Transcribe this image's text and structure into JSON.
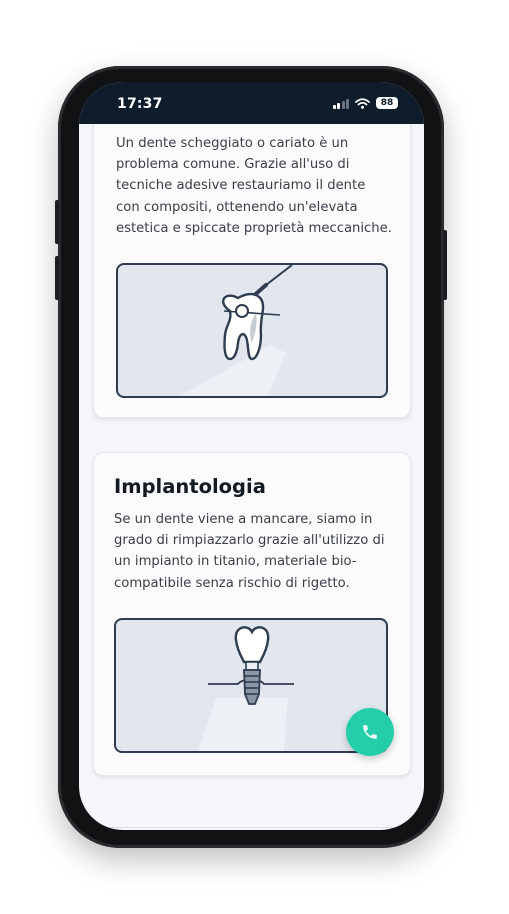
{
  "status_bar": {
    "time": "17:37",
    "battery": "88",
    "icons": [
      "signal-icon",
      "wifi-icon",
      "battery-icon"
    ]
  },
  "cards": [
    {
      "text": "Un dente scheggiato o cariato è un problema comune. Grazie all'uso di tecniche adesive restauriamo il dente con compositi, ottenendo un'elevata estetica e spiccate proprietà meccaniche.",
      "illustration": "tooth-restoration-icon"
    },
    {
      "title": "Implantologia",
      "text": "Se un dente viene a mancare, siamo in grado di rimpiazzarlo grazie all'utilizzo di un impianto in titanio, materiale bio-compatibile senza rischio di rigetto.",
      "illustration": "dental-implant-icon"
    }
  ],
  "call_button": {
    "icon": "phone-icon",
    "color": "#24ceaa"
  },
  "colors": {
    "status_bar_bg": "#0f1c2c",
    "accent": "#24ceaa",
    "illustration_bg": "#e1e6ef",
    "illustration_stroke": "#2f3c4f"
  }
}
